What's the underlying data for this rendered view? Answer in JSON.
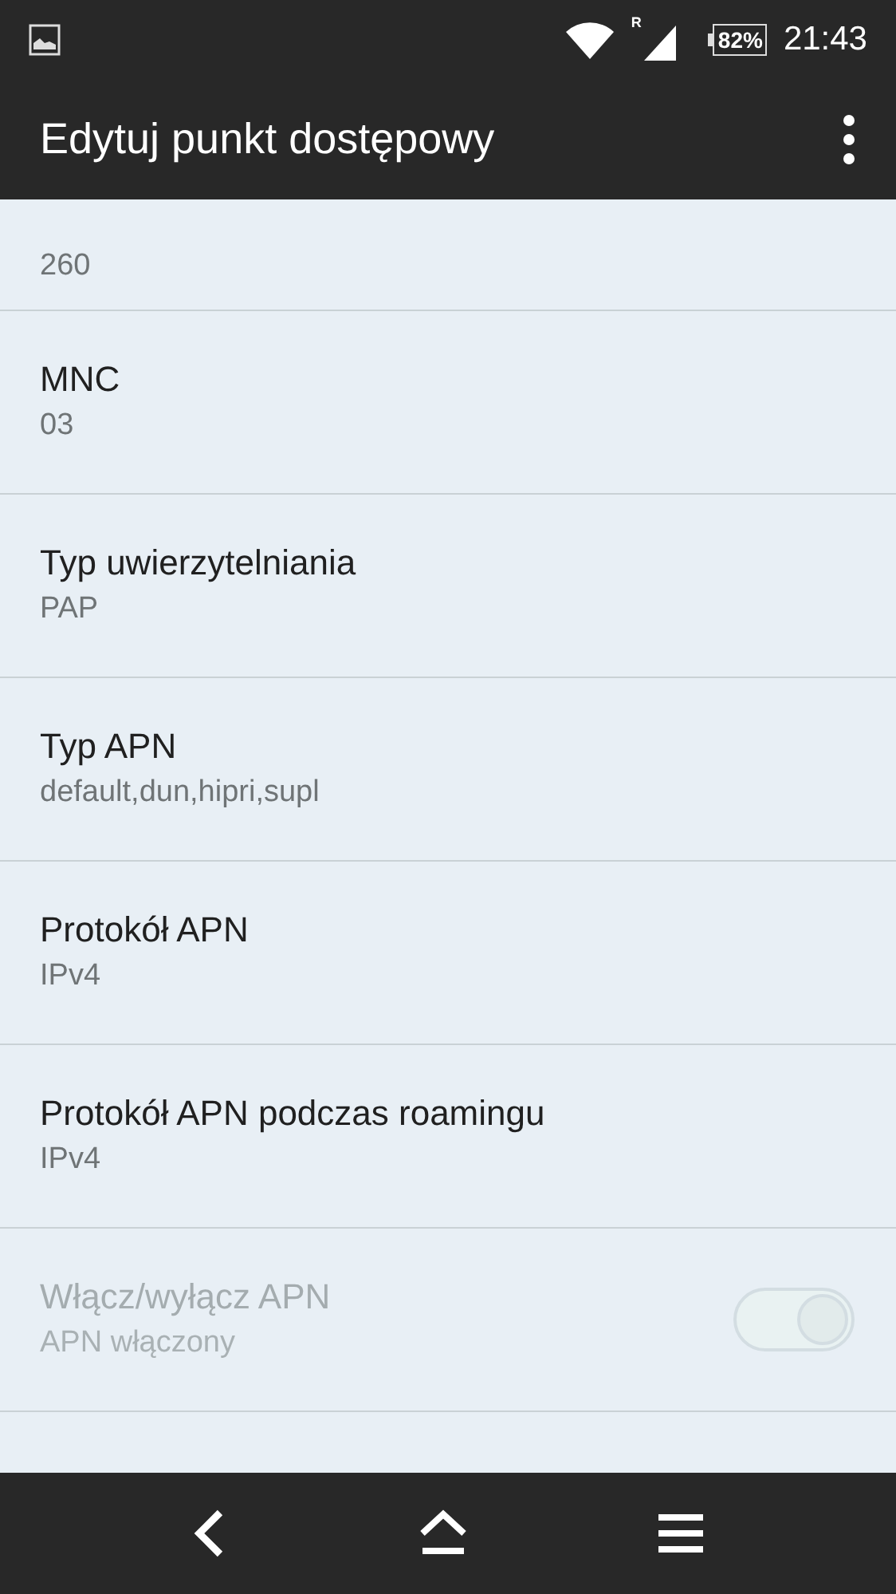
{
  "status_bar": {
    "battery": "82%",
    "roaming": "R",
    "time": "21:43"
  },
  "app_bar": {
    "title": "Edytuj punkt dostępowy"
  },
  "items": [
    {
      "kind": "text",
      "value": "260",
      "disabled": false
    },
    {
      "kind": "text",
      "title": "MNC",
      "value": "03",
      "disabled": false
    },
    {
      "kind": "text",
      "title": "Typ uwierzytelniania",
      "value": "PAP",
      "disabled": false
    },
    {
      "kind": "text",
      "title": "Typ APN",
      "value": "default,dun,hipri,supl",
      "disabled": false
    },
    {
      "kind": "text",
      "title": "Protokół APN",
      "value": "IPv4",
      "disabled": false
    },
    {
      "kind": "text",
      "title": "Protokół APN podczas roamingu",
      "value": "IPv4",
      "disabled": false
    },
    {
      "kind": "switch",
      "title": "Włącz/wyłącz APN",
      "value": "APN włączony",
      "disabled": true,
      "checked": true
    }
  ]
}
